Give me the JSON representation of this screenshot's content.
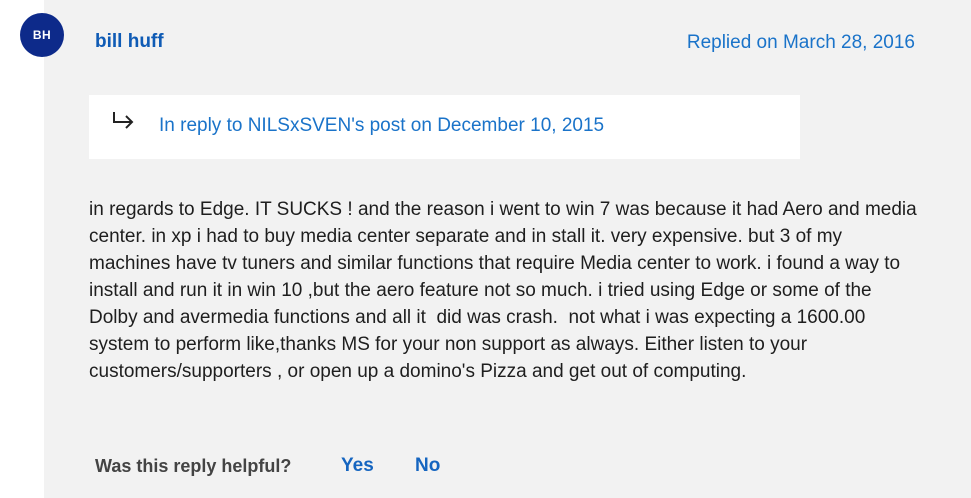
{
  "post": {
    "avatar_initials": "BH",
    "author": "bill huff",
    "replied_on": "Replied on March 28, 2016",
    "reply_arrow_icon": "reply-arrow-icon",
    "in_reply_to": "In reply to NILSxSVEN's post on December 10, 2015",
    "body": "in regards to Edge. IT SUCKS ! and the reason i went to win 7 was because it had Aero and media center. in xp i had to buy media center separate and in stall it. very expensive. but 3 of my machines have tv tuners and similar functions that require Media center to work. i found a way to install and run it in win 10 ,but the aero feature not so much. i tried using Edge or some of the Dolby and avermedia functions and all it  did was crash.  not what i was expecting a 1600.00 system to perform like,thanks MS for your non support as always. Either listen to your customers/supporters , or open up a domino's Pizza and get out of computing."
  },
  "feedback": {
    "question": "Was this reply helpful?",
    "yes_label": "Yes",
    "no_label": "No"
  }
}
